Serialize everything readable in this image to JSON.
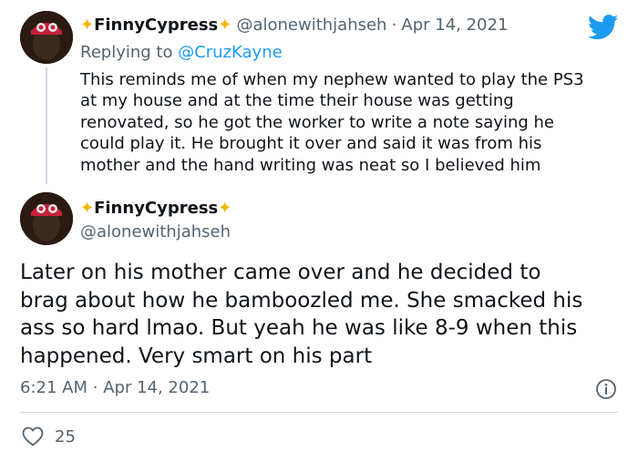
{
  "reply_tweet": {
    "name": "FinnyCypress",
    "handle": "@alonewithjahseh",
    "separator": "·",
    "date": "Apr 14, 2021",
    "replying_prefix": "Replying to ",
    "replying_to": "@CruzKayne",
    "text": "This reminds me of when my nephew wanted to play the PS3\nat my house and at the time their house was getting\nrenovated, so he got the worker to write a note saying he\ncould play it. He brought it over and said it was from his\nmother and the hand writing was neat so I believed him"
  },
  "main_tweet": {
    "name": "FinnyCypress",
    "handle": "@alonewithjahseh",
    "text": "Later on his mother came over and he decided to\nbrag about how he bamboozled me. She smacked his\nass so hard lmao. But yeah he was like 8-9 when this\nhappened. Very smart on his part",
    "time": "6:21 AM",
    "separator": "·",
    "date": "Apr 14, 2021",
    "likes": "25"
  },
  "icons": {
    "brand": "twitter-bird-icon",
    "sparkle": "sparkle-emoji",
    "info": "info-icon",
    "like": "heart-icon"
  },
  "colors": {
    "twitter_blue": "#1d9bf0",
    "secondary_text": "#536471",
    "sparkle": "#f4b400"
  }
}
